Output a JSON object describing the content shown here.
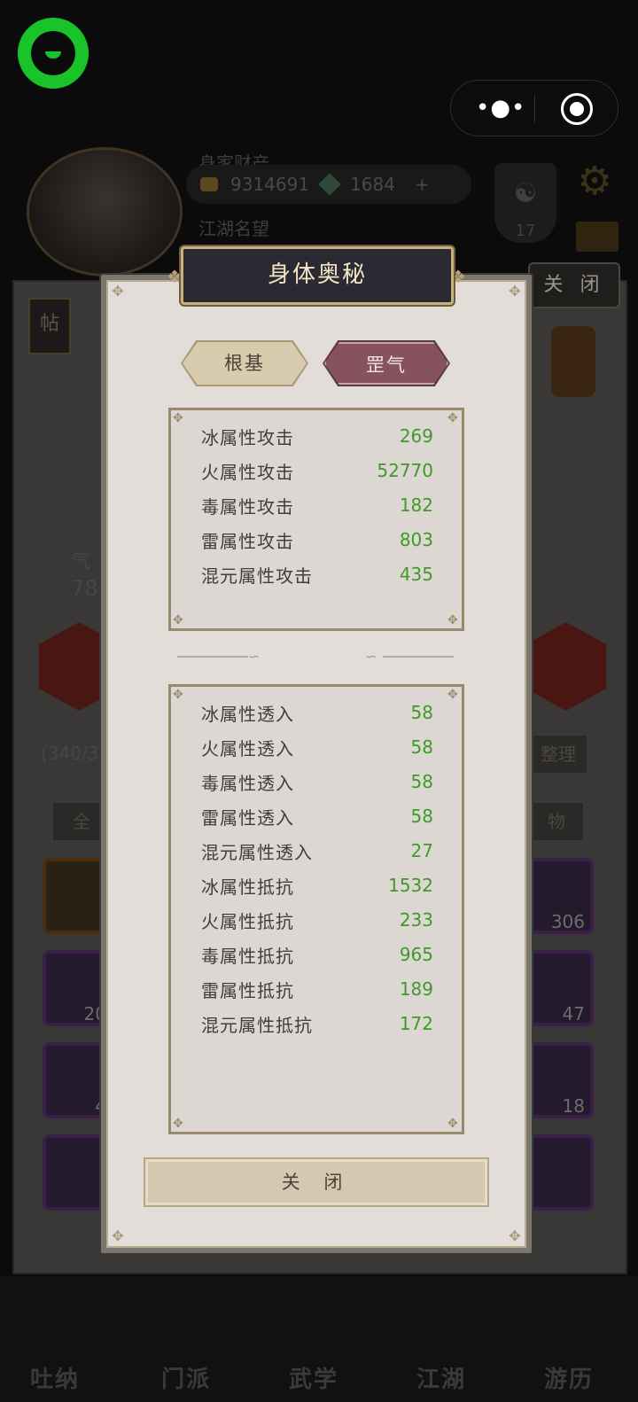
{
  "background": {
    "wealth_label": "身家财产",
    "coins": "9314691",
    "gems": "1684",
    "plus": "+",
    "fame_label": "江湖名望",
    "level_badge": "17",
    "close_tab": "关 闭",
    "post_badge": "帖",
    "qi_label": "气",
    "power_value": "78",
    "capacity": "(340/3",
    "organize_label": "整理",
    "filter_all": "全",
    "filter_item": "物",
    "slot_counts": [
      "20",
      "4",
      "306",
      "47",
      "18"
    ],
    "nav_items": [
      "吐纳",
      "门派",
      "武学",
      "江湖",
      "游历"
    ]
  },
  "capsule": {
    "more_icon": "more-dots-icon",
    "target_icon": "target-circle-icon"
  },
  "dialog": {
    "title": "身体奥秘",
    "tabs": [
      {
        "label": "根基",
        "active": false
      },
      {
        "label": "罡气",
        "active": true
      }
    ],
    "attack_stats": [
      {
        "label": "冰属性攻击",
        "value": "269"
      },
      {
        "label": "火属性攻击",
        "value": "52770"
      },
      {
        "label": "毒属性攻击",
        "value": "182"
      },
      {
        "label": "雷属性攻击",
        "value": "803"
      },
      {
        "label": "混元属性攻击",
        "value": "435"
      }
    ],
    "defense_stats": [
      {
        "label": "冰属性透入",
        "value": "58"
      },
      {
        "label": "火属性透入",
        "value": "58"
      },
      {
        "label": "毒属性透入",
        "value": "58"
      },
      {
        "label": "雷属性透入",
        "value": "58"
      },
      {
        "label": "混元属性透入",
        "value": "27"
      },
      {
        "label": "冰属性抵抗",
        "value": "1532"
      },
      {
        "label": "火属性抵抗",
        "value": "233"
      },
      {
        "label": "毒属性抵抗",
        "value": "965"
      },
      {
        "label": "雷属性抵抗",
        "value": "189"
      },
      {
        "label": "混元属性抵抗",
        "value": "172"
      }
    ],
    "close_label": "关 闭"
  },
  "colors": {
    "stat_value": "#3f9a28",
    "active_tab": "#86525e",
    "inactive_tab": "#d8cbae",
    "title_bar": "#2b2a33"
  }
}
